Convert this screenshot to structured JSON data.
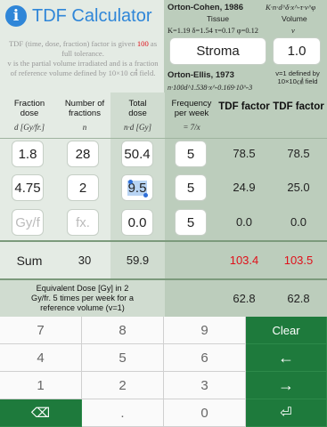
{
  "app": {
    "title": "TDF Calculator",
    "description_pre": "TDF (time, dose, fraction) factor is given ",
    "description_hl": "100",
    "description_post": " as full tolerance.",
    "description_line2": "v is the partial volume irradiated and is a fraction of reference volume defined by 10×10 ㎠ field."
  },
  "orton_cohen": {
    "title": "Orton-Cohen, 1986",
    "formula": "K·n·d^δ·x^-τ·v^φ",
    "tissue_label": "Tissue",
    "volume_label": "Volume",
    "params": "K=1.19 δ=1.54 τ=0.17 φ=0.12",
    "volume_symbol": "v",
    "tissue_value": "Stroma",
    "volume_value": "1.0"
  },
  "orton_ellis": {
    "title": "Orton-Ellis, 1973",
    "formula": "n·100d^1.538·x^-0.169·10^-3",
    "volume_note": "v=1 defined by 10×10㎠ field"
  },
  "columns": {
    "fraction_dose": "Fraction dose",
    "fraction_dose_sub": "d [Gy/fr.]",
    "num_fractions": "Number of fractions",
    "num_fractions_sub": "n",
    "total_dose": "Total dose",
    "total_dose_sub": "n·d [Gy]",
    "frequency": "Frequency per week",
    "frequency_sub": "= 7/x",
    "tdf1": "TDF factor",
    "tdf2": "TDF factor"
  },
  "rows": [
    {
      "dose": "1.8",
      "fractions": "28",
      "total": "50.4",
      "freq": "5",
      "tdf1": "78.5",
      "tdf2": "78.5"
    },
    {
      "dose": "4.75",
      "fractions": "2",
      "total": "9.5",
      "freq": "5",
      "tdf1": "24.9",
      "tdf2": "25.0"
    },
    {
      "dose": "Gy/f",
      "fractions": "fx.",
      "total": "0.0",
      "freq": "5",
      "tdf1": "0.0",
      "tdf2": "0.0"
    }
  ],
  "sum": {
    "label": "Sum",
    "fractions": "30",
    "total": "59.9",
    "tdf1": "103.4",
    "tdf2": "103.5"
  },
  "equivalent": {
    "text": "Equivalent Dose [Gy] in 2 Gy/fr. 5 times per week for a reference volume (v=1)",
    "val1": "62.8",
    "val2": "62.8"
  },
  "keyboard": {
    "keys": [
      "7",
      "8",
      "9",
      "4",
      "5",
      "6",
      "1",
      "2",
      "3",
      ".",
      "0"
    ],
    "clear": "Clear",
    "delete_symbol": "⌫",
    "left_arrow": "←",
    "right_arrow": "→",
    "enter_symbol": "⏎"
  },
  "colors": {
    "accent": "#2f86d8",
    "red": "#e0101a",
    "green_key": "#1e7a3c"
  }
}
